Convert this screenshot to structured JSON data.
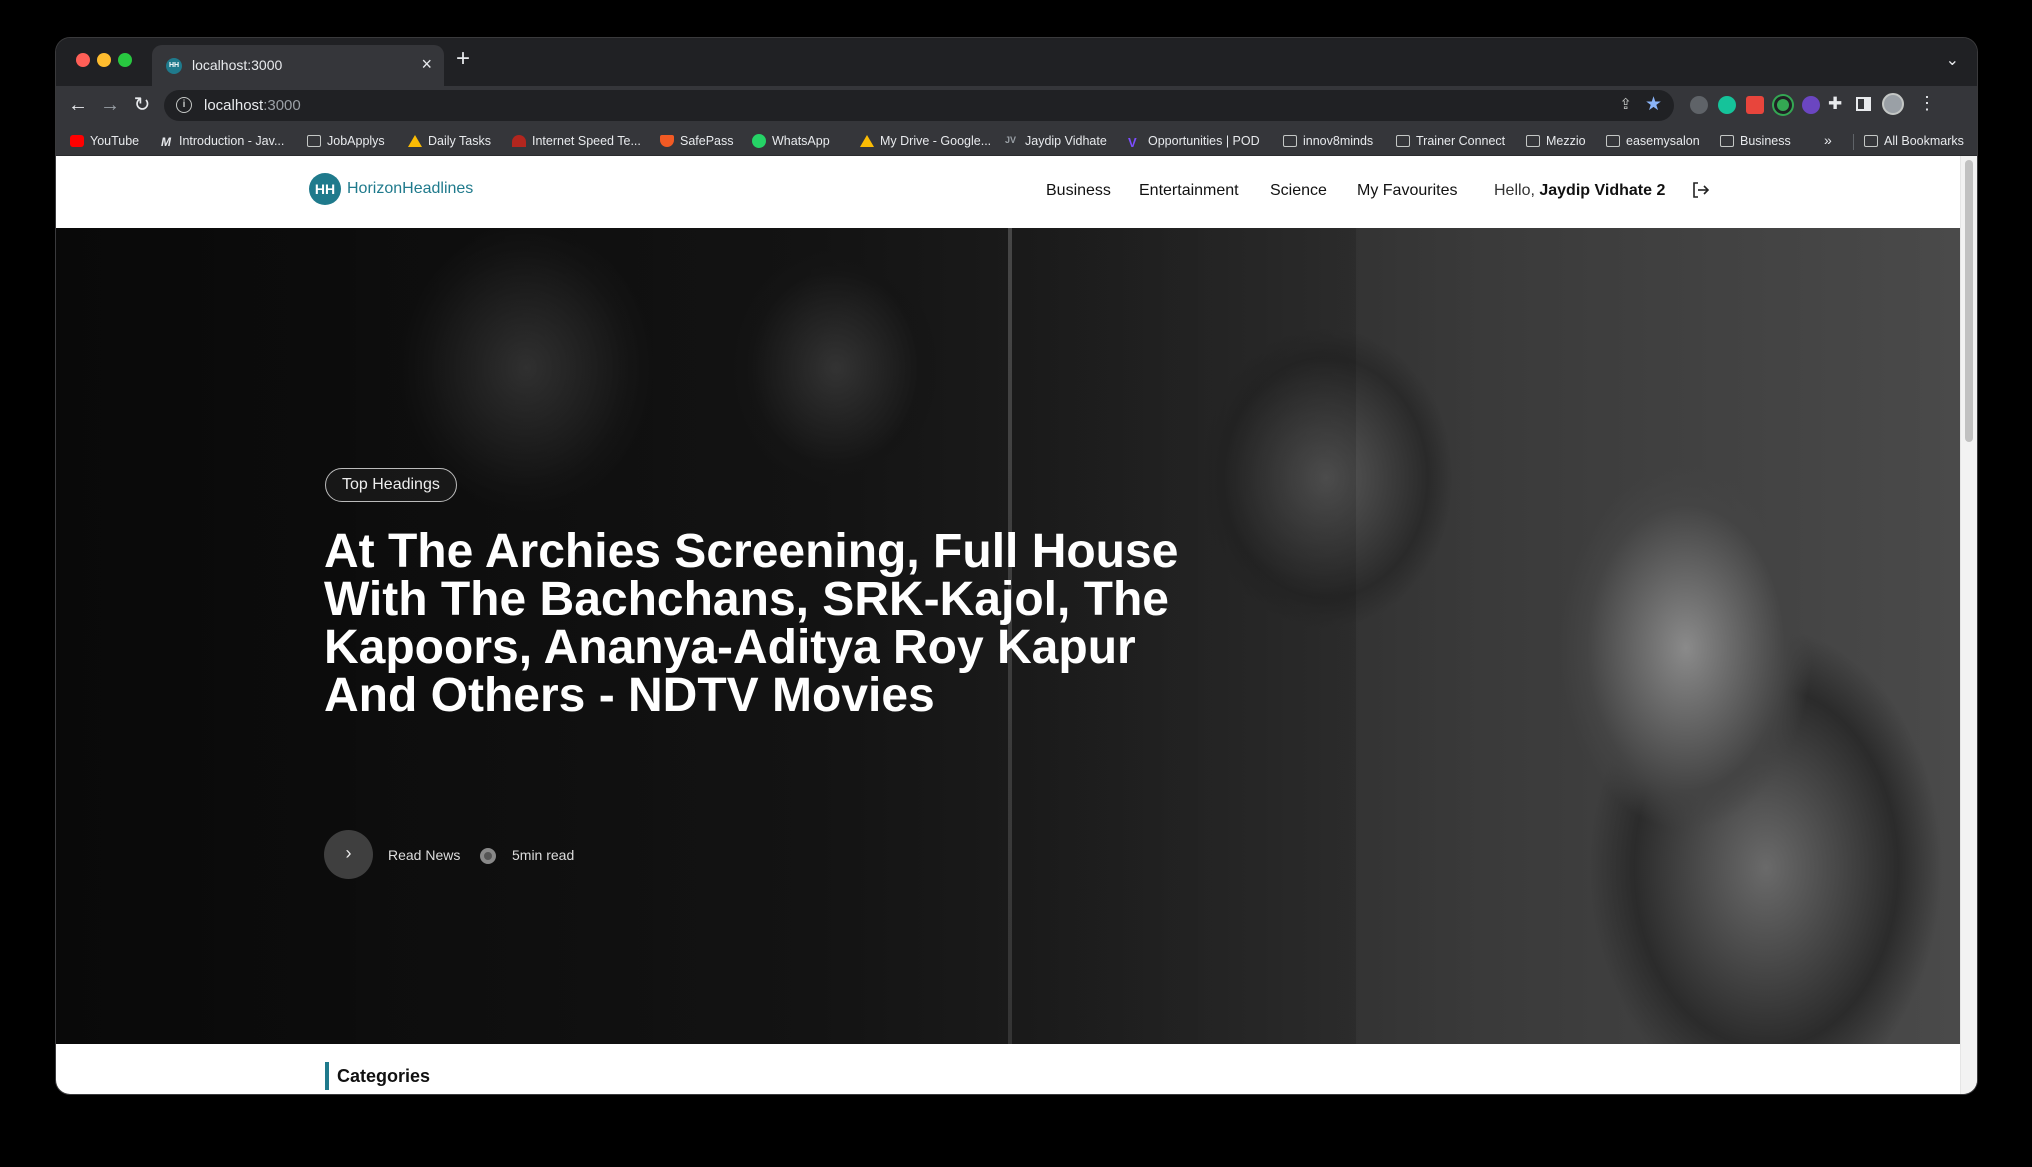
{
  "browser": {
    "tab_title": "localhost:3000",
    "tab_favicon_text": "HH",
    "tab_close": "×",
    "new_tab": "+",
    "url_host": "localhost",
    "url_port": ":3000",
    "bookmarks": [
      {
        "label": "YouTube",
        "icon": "youtube-icon"
      },
      {
        "label": "Introduction - Jav...",
        "icon": "m-icon"
      },
      {
        "label": "JobApplys",
        "icon": "folder-icon"
      },
      {
        "label": "Daily Tasks",
        "icon": "drive-icon"
      },
      {
        "label": "Internet Speed Te...",
        "icon": "speedometer-icon"
      },
      {
        "label": "SafePass",
        "icon": "shield-icon"
      },
      {
        "label": "WhatsApp",
        "icon": "whatsapp-icon"
      },
      {
        "label": "My Drive - Google...",
        "icon": "drive-icon"
      },
      {
        "label": "Jaydip Vidhate",
        "icon": "jv-icon"
      },
      {
        "label": "Opportunities | POD",
        "icon": "v-icon"
      },
      {
        "label": "innov8minds",
        "icon": "folder-icon"
      },
      {
        "label": "Trainer Connect",
        "icon": "folder-icon"
      },
      {
        "label": "Mezzio",
        "icon": "folder-icon"
      },
      {
        "label": "easemysalon",
        "icon": "folder-icon"
      },
      {
        "label": "Business",
        "icon": "folder-icon"
      }
    ],
    "bookmarks_more": "»",
    "all_bookmarks": "All Bookmarks"
  },
  "site": {
    "logo_badge": "HH",
    "logo_text": "HorizonHeadlines",
    "nav": {
      "business": "Business",
      "entertainment": "Entertainment",
      "science": "Science",
      "favourites": "My Favourites"
    },
    "greeting_prefix": "Hello, ",
    "user_name": "Jaydip Vidhate 2"
  },
  "hero": {
    "tag": "Top Headings",
    "title": "At The Archies Screening, Full House With The Bachchans, SRK-Kajol, The Kapoors, Ananya-Aditya Roy Kapur And Others - NDTV Movies",
    "read_label": "Read News",
    "read_time": "5min read"
  },
  "sections": {
    "categories_title": "Categories"
  },
  "colors": {
    "brand": "#1f7a8c",
    "star": "#8ab4f8"
  }
}
